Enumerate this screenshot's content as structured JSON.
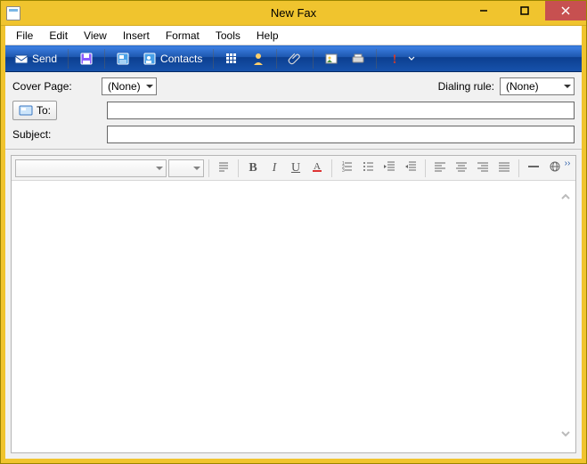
{
  "window": {
    "title": "New Fax"
  },
  "menu": {
    "file": "File",
    "edit": "Edit",
    "view": "View",
    "insert": "Insert",
    "format": "Format",
    "tools": "Tools",
    "help": "Help"
  },
  "toolbar": {
    "send": "Send",
    "contacts": "Contacts"
  },
  "header": {
    "cover_page_label": "Cover Page:",
    "cover_page_value": "(None)",
    "dialing_rule_label": "Dialing rule:",
    "dialing_rule_value": "(None)",
    "to_label": "To:",
    "to_value": "",
    "subject_label": "Subject:",
    "subject_value": ""
  },
  "format": {
    "font_name": "",
    "font_size": ""
  }
}
